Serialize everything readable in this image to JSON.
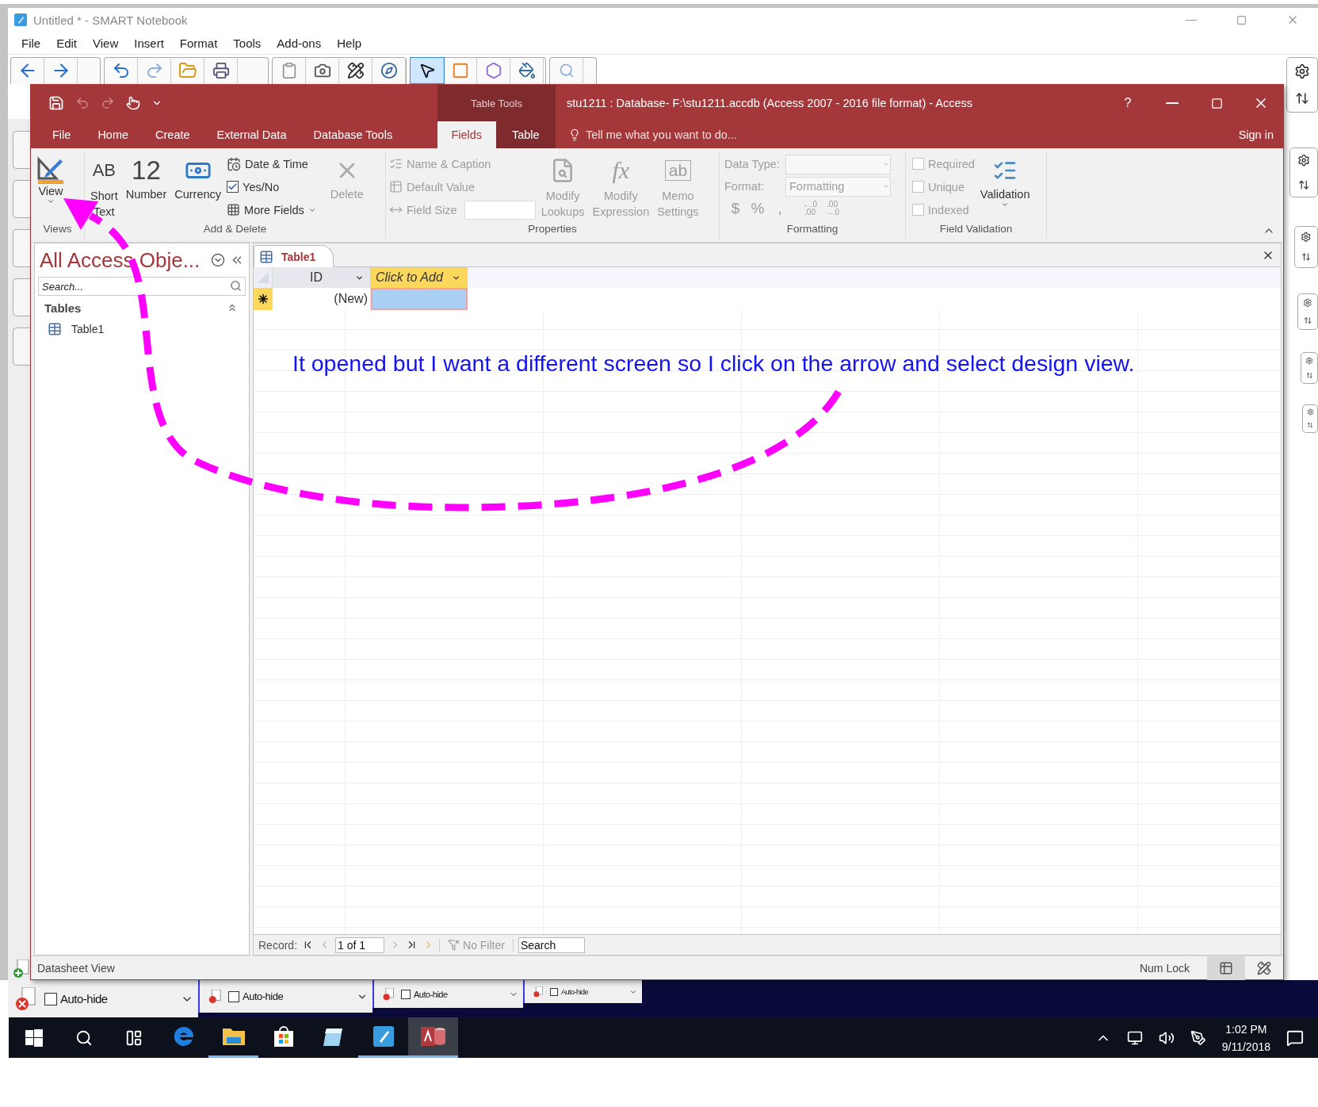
{
  "smart_window": {
    "title": "Untitled * - SMART Notebook",
    "menu": [
      "File",
      "Edit",
      "View",
      "Insert",
      "Format",
      "Tools",
      "Add-ons",
      "Help"
    ],
    "tools": [
      {
        "selected": true
      },
      {
        "selected": false
      },
      {
        "selected": false
      },
      {
        "selected": false
      }
    ]
  },
  "access": {
    "context_label": "Table Tools",
    "title": "stu1211 : Database- F:\\stu1211.accdb (Access 2007 - 2016 file format) - Access",
    "help": "?",
    "tabs": [
      {
        "label": "File",
        "selected": false
      },
      {
        "label": "Home",
        "selected": false
      },
      {
        "label": "Create",
        "selected": false
      },
      {
        "label": "External Data",
        "selected": false
      },
      {
        "label": "Database Tools",
        "selected": false
      }
    ],
    "context_tabs": [
      {
        "label": "Fields",
        "selected": true
      },
      {
        "label": "Table",
        "selected": false
      }
    ],
    "tell_me": "Tell me what you want to do...",
    "sign_in": "Sign in",
    "ribbon": {
      "views": {
        "label": "Views",
        "view_button": "View"
      },
      "add_delete": {
        "label": "Add & Delete",
        "short_text": {
          "glyph": "AB",
          "label": "Short Text"
        },
        "number": {
          "glyph": "12",
          "label": "Number"
        },
        "currency": "Currency",
        "date_time": "Date & Time",
        "yes_no": {
          "label": "Yes/No",
          "checked": true
        },
        "more_fields": "More Fields",
        "delete": {
          "label": "Delete",
          "disabled": true
        }
      },
      "properties": {
        "label": "Properties",
        "disabled": true,
        "name_caption": "Name & Caption",
        "default_value": "Default Value",
        "field_size": "Field Size",
        "modify_lookups": "Modify Lookups",
        "modify_expression": {
          "glyph": "fx",
          "label": "Modify Expression"
        },
        "memo_settings": {
          "glyph": "ab",
          "label": "Memo Settings"
        }
      },
      "formatting": {
        "label": "Formatting",
        "disabled": true,
        "data_type_label": "Data Type:",
        "format_label": "Format:",
        "format_value": "Formatting",
        "symbols": [
          "$",
          "%",
          ","
        ],
        "decimals": [
          [
            "←.0",
            ".00"
          ],
          [
            ".00",
            "→.0"
          ]
        ]
      },
      "field_validation": {
        "label": "Field Validation",
        "checks": [
          {
            "label": "Required",
            "checked": false,
            "disabled": true
          },
          {
            "label": "Unique",
            "checked": false,
            "disabled": true
          },
          {
            "label": "Indexed",
            "checked": false,
            "disabled": true
          }
        ],
        "validation": "Validation"
      }
    },
    "nav_pane": {
      "title": "All Access Obje...",
      "search_placeholder": "Search...",
      "group": "Tables",
      "items": [
        "Table1"
      ]
    },
    "document": {
      "tab": "Table1",
      "columns": [
        {
          "label": "ID",
          "selected": false
        },
        {
          "label": "Click to Add",
          "selected": true
        }
      ],
      "new_row": {
        "id": "(New)"
      }
    },
    "record_bar": {
      "label": "Record:",
      "position": "1 of 1",
      "filter": "No Filter",
      "search": "Search"
    },
    "status_bar": {
      "text": "Datasheet View",
      "num_lock": "Num Lock"
    }
  },
  "annotation": {
    "text": "It opened but I want a different screen so I click on the arrow and select design view."
  },
  "auto_hide": [
    {
      "label": "Auto-hide",
      "checked": false
    },
    {
      "label": "Auto-hide",
      "checked": false
    },
    {
      "label": "Auto-hide",
      "checked": false
    },
    {
      "label": "Auto-hide",
      "checked": false
    }
  ],
  "taskbar": {
    "apps": [
      {
        "running": false,
        "active": false
      },
      {
        "running": true,
        "active": false
      },
      {
        "running": false,
        "active": false
      },
      {
        "running": false,
        "active": false
      },
      {
        "running": true,
        "active": false
      },
      {
        "running": true,
        "active": true
      }
    ],
    "time": "1:02 PM",
    "date": "9/11/2018"
  }
}
